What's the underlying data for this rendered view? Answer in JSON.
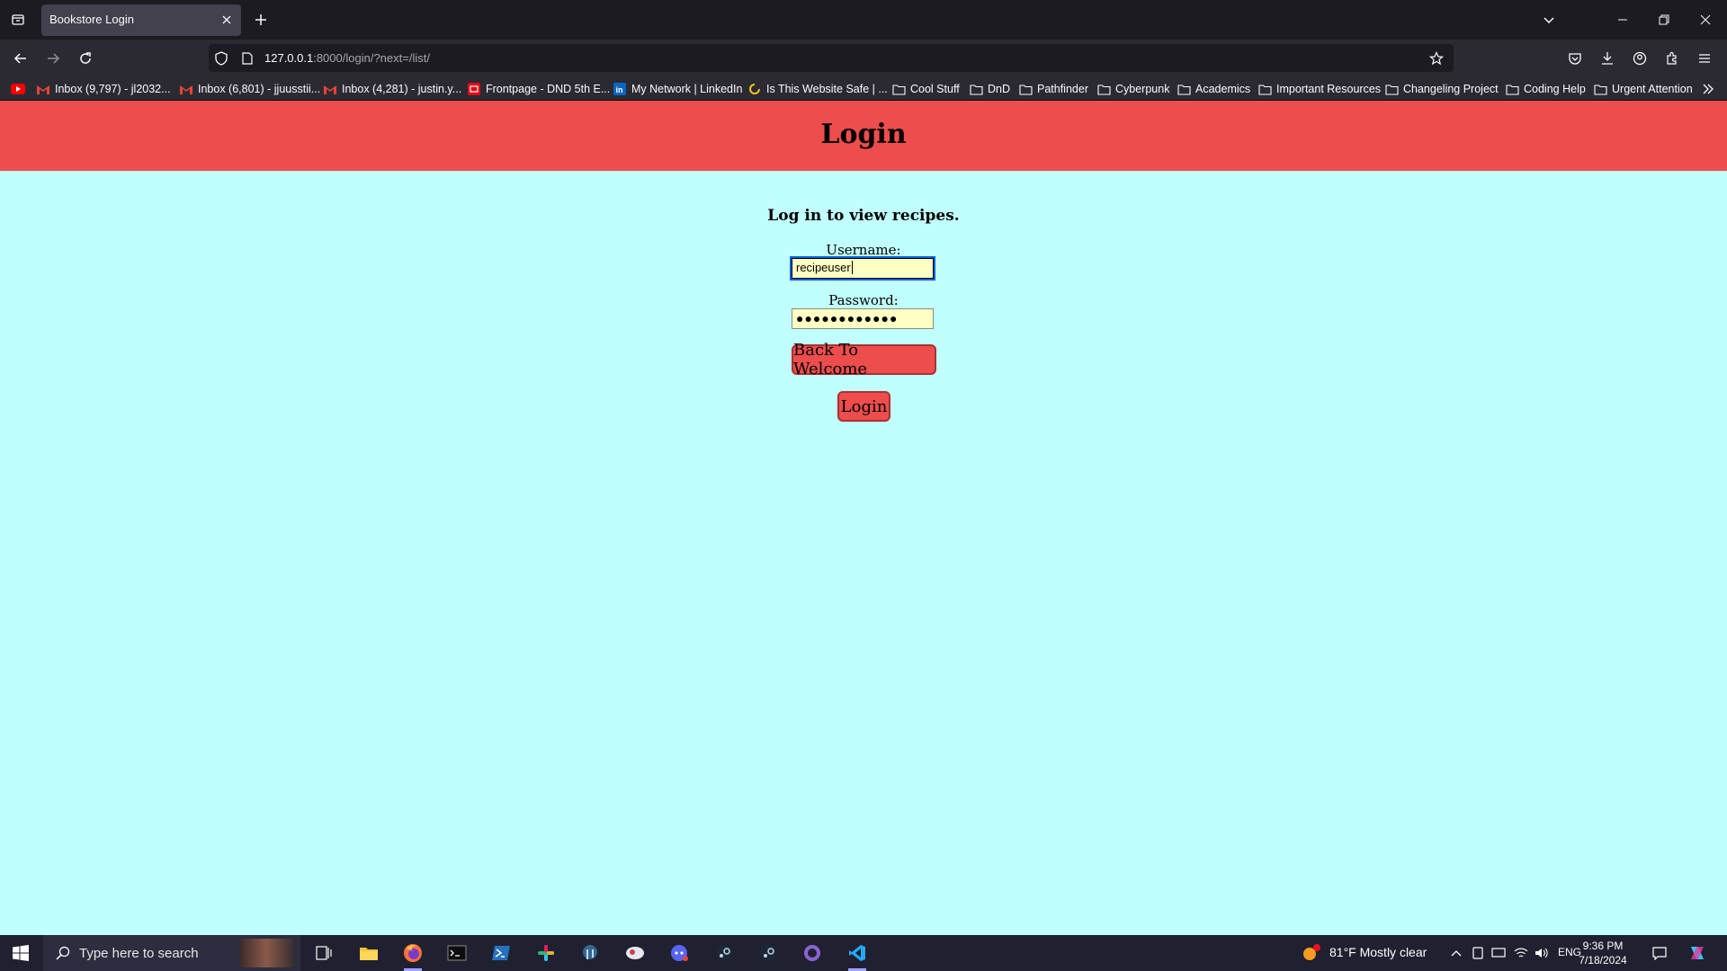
{
  "browser": {
    "tab_title": "Bookstore Login",
    "url_host": "127.0.0.1",
    "url_rest": ":8000/login/?next=/list/",
    "bookmarks": [
      {
        "label": "Inbox (9,797) - jl2032...",
        "icon": "gmail-icon"
      },
      {
        "label": "Inbox (6,801) - jjuusstii...",
        "icon": "gmail-icon"
      },
      {
        "label": "Inbox (4,281) - justin.y...",
        "icon": "gmail-icon"
      },
      {
        "label": "Frontpage - DND 5th E...",
        "icon": "dnd-icon"
      },
      {
        "label": "My Network | LinkedIn",
        "icon": "linkedin-icon"
      },
      {
        "label": "Is This Website Safe | ...",
        "icon": "loading-icon"
      },
      {
        "label": "Cool Stuff",
        "icon": "folder-icon"
      },
      {
        "label": "DnD",
        "icon": "folder-icon"
      },
      {
        "label": "Pathfinder",
        "icon": "folder-icon"
      },
      {
        "label": "Cyberpunk",
        "icon": "folder-icon"
      },
      {
        "label": "Academics",
        "icon": "folder-icon"
      },
      {
        "label": "Important Resources",
        "icon": "folder-icon"
      },
      {
        "label": "Changeling Project",
        "icon": "folder-icon"
      },
      {
        "label": "Coding Help",
        "icon": "folder-icon"
      },
      {
        "label": "Urgent Attention",
        "icon": "folder-icon"
      }
    ]
  },
  "page": {
    "header_title": "Login",
    "intro": "Log in to view recipes.",
    "username_label": "Username:",
    "username_value": "recipeuser",
    "password_label": "Password:",
    "password_value": "●●●●●●●●●●●●",
    "back_button": "Back To Welcome",
    "login_button": "Login"
  },
  "taskbar": {
    "search_placeholder": "Type here to search",
    "weather": "81°F  Mostly clear",
    "language": "ENG",
    "time": "9:36 PM",
    "date": "7/18/2024"
  },
  "colors": {
    "page_background": "#c0fffd",
    "header_background": "#ee4d4d",
    "input_background": "#ffffc4",
    "button_background": "#ee4d4d"
  }
}
